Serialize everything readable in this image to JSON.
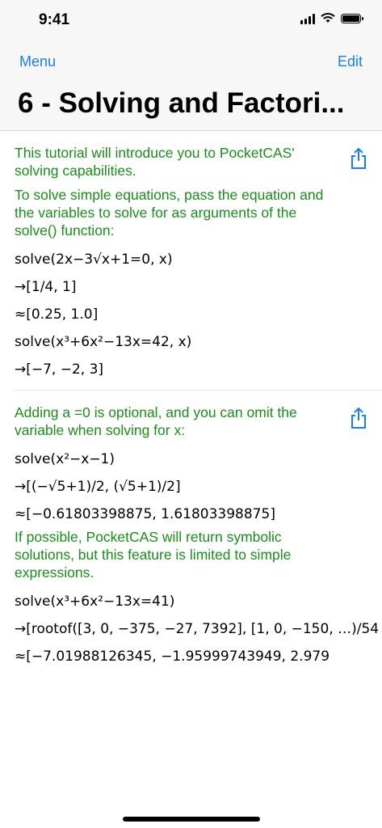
{
  "status": {
    "time": "9:41"
  },
  "nav": {
    "back": "Menu",
    "edit": "Edit",
    "title": "6 - Solving and Factori..."
  },
  "sections": [
    {
      "paras": [
        "This tutorial will introduce you to PocketCAS' solving capabilities.",
        "To solve simple equations, pass the equation and the variables to solve for as arguments of the solve() function:"
      ],
      "lines": [
        "solve(2x−3√x+1=0, x)",
        "→[1/4, 1]",
        "≈[0.25, 1.0]",
        "solve(x³+6x²−13x=42, x)",
        "→[−7, −2, 3]"
      ]
    },
    {
      "paras": [
        "Adding a =0 is optional, and you can omit the variable when solving for x:"
      ],
      "lines": [
        "solve(x²−x−1)",
        "→[(−√5+1)/2, (√5+1)/2]",
        "≈[−0.61803398875, 1.61803398875]"
      ],
      "paras2": [
        "If possible, PocketCAS will return symbolic solutions, but this feature is limited to simple expressions."
      ],
      "lines2": [
        "solve(x³+6x²−13x=41)",
        "→[rootof([3, 0, −375, −27, 7392], [1, 0, −150, …)/54",
        "≈[−7.01988126345, −1.95999743949, 2.979"
      ]
    }
  ],
  "colors": {
    "accent": "#1a7ef0",
    "text_green": "#1a8d1a"
  }
}
